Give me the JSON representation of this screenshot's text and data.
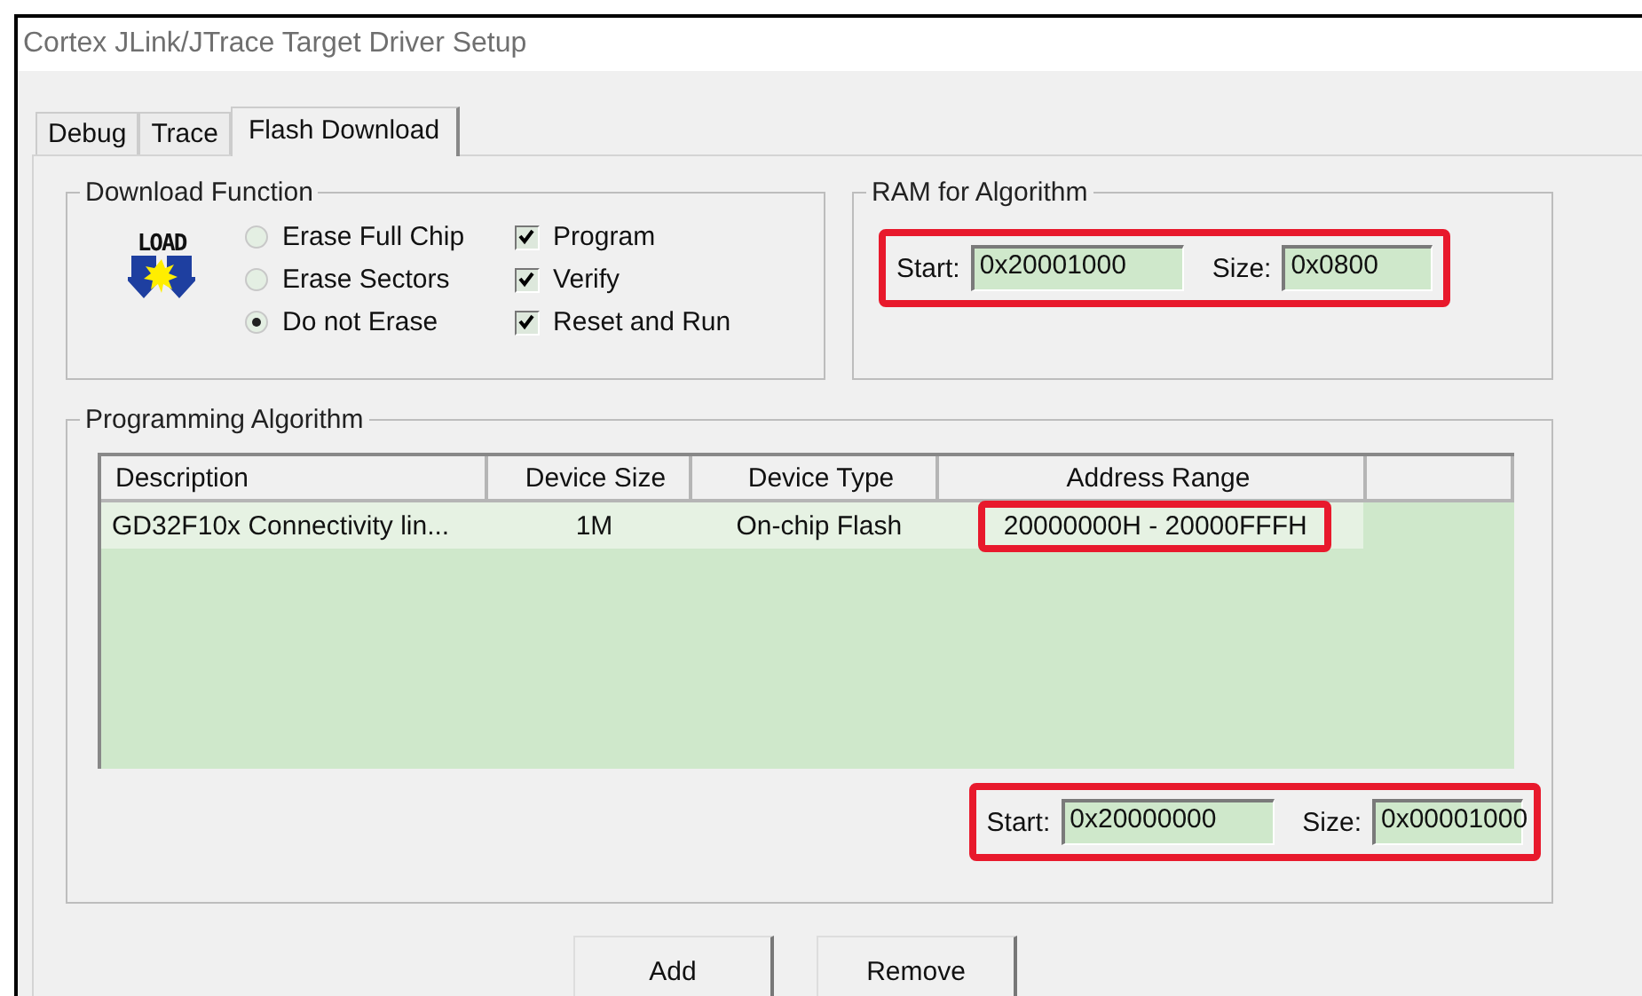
{
  "window": {
    "title": "Cortex JLink/JTrace Target Driver Setup"
  },
  "tabs": [
    {
      "label": "Debug",
      "selected": false
    },
    {
      "label": "Trace",
      "selected": false
    },
    {
      "label": "Flash Download",
      "selected": true
    }
  ],
  "download_function": {
    "title": "Download Function",
    "icon_label": "LOAD",
    "erase_options": [
      {
        "label": "Erase Full Chip",
        "selected": false
      },
      {
        "label": "Erase Sectors",
        "selected": false
      },
      {
        "label": "Do not Erase",
        "selected": true
      }
    ],
    "actions": [
      {
        "label": "Program",
        "checked": true
      },
      {
        "label": "Verify",
        "checked": true
      },
      {
        "label": "Reset and Run",
        "checked": true
      }
    ]
  },
  "ram_for_algorithm": {
    "title": "RAM for Algorithm",
    "highlighted": true,
    "start_label": "Start:",
    "start": "0x20001000",
    "size_label": "Size:",
    "size": "0x0800"
  },
  "programming_algorithm": {
    "title": "Programming Algorithm",
    "table": {
      "columns": [
        "Description",
        "Device Size",
        "Device Type",
        "Address Range"
      ],
      "rows": [
        {
          "description": "GD32F10x Connectivity lin...",
          "device_size": "1M",
          "device_type": "On-chip Flash",
          "address_range": "20000000H - 20000FFFH",
          "selected": true,
          "address_highlighted": true
        }
      ]
    },
    "range": {
      "highlighted": true,
      "start_label": "Start:",
      "start": "0x20000000",
      "size_label": "Size:",
      "size": "0x00001000"
    }
  },
  "buttons": [
    "Add",
    "Remove"
  ]
}
